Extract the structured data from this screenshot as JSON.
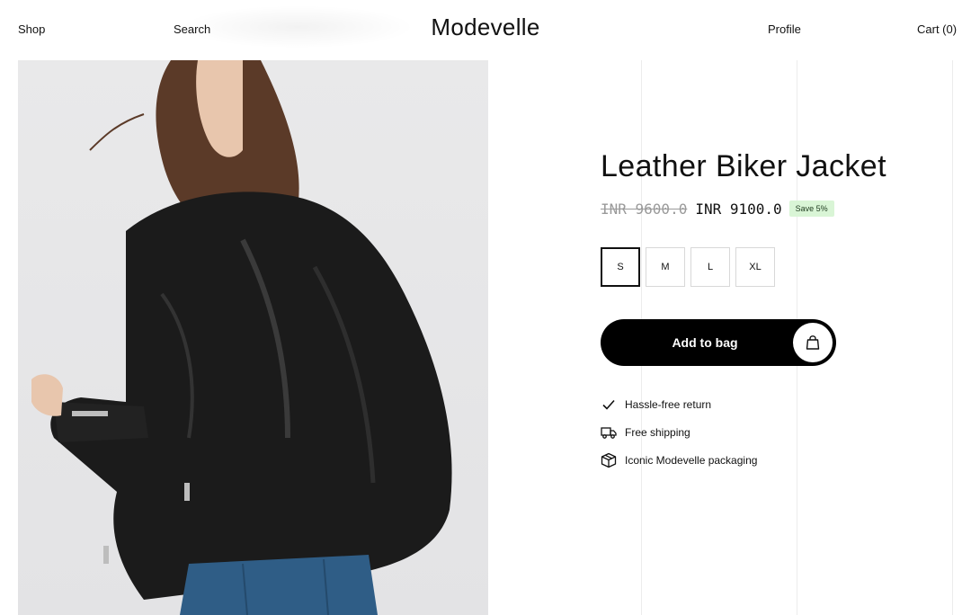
{
  "header": {
    "shop_label": "Shop",
    "search_label": "Search",
    "brand": "Modevelle",
    "profile_label": "Profile",
    "cart_label": "Cart (0)"
  },
  "product": {
    "title": "Leather Biker Jacket",
    "image_alt": "Woman wearing black leather biker jacket",
    "price_original": "INR 9600.0",
    "price_current": "INR 9100.0",
    "save_badge": "Save 5%",
    "sizes": [
      "S",
      "M",
      "L",
      "XL"
    ],
    "selected_size": "S",
    "add_to_bag_label": "Add to bag",
    "features": [
      {
        "icon": "check-icon",
        "label": "Hassle-free return"
      },
      {
        "icon": "truck-icon",
        "label": "Free shipping"
      },
      {
        "icon": "package-icon",
        "label": "Iconic Modevelle packaging"
      }
    ]
  },
  "colors": {
    "accent": "#000000",
    "save_badge_bg": "#d9f5d6",
    "muted_price": "#9a9a9a"
  }
}
